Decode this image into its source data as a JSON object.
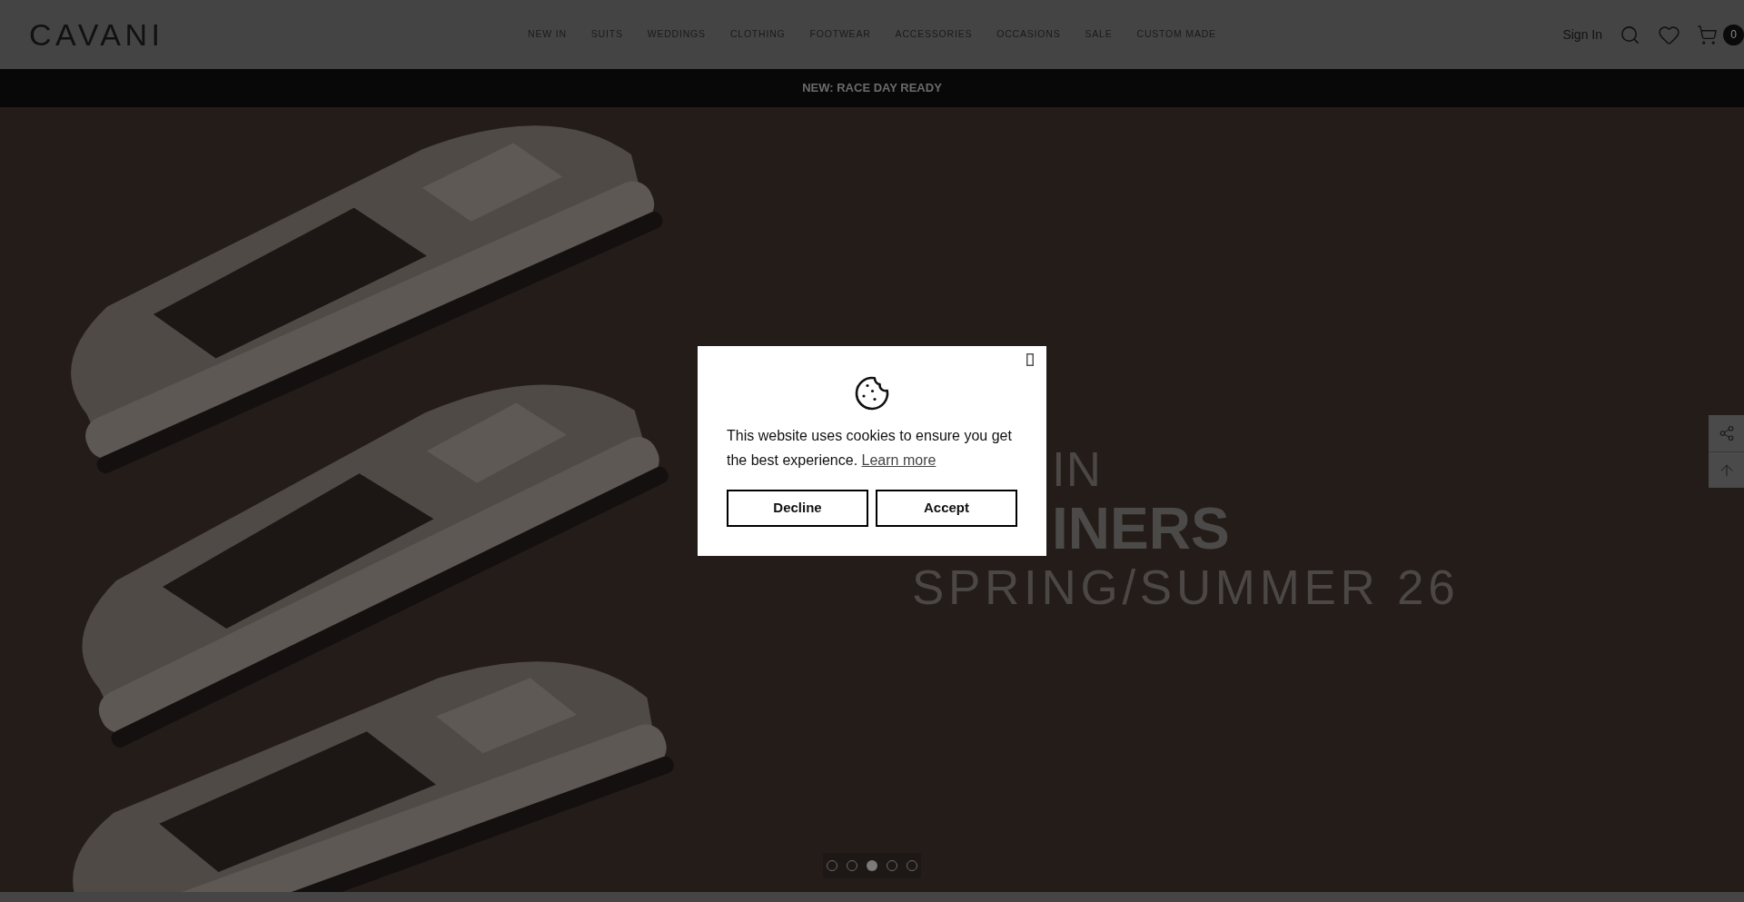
{
  "header": {
    "logo": "CAVANI",
    "nav": [
      "NEW IN",
      "SUITS",
      "WEDDINGS",
      "CLOTHING",
      "FOOTWEAR",
      "ACCESSORIES",
      "OCCASIONS",
      "SALE",
      "CUSTOM MADE"
    ],
    "sign_in": "Sign In",
    "cart_count": "0"
  },
  "announcement": "NEW: RACE DAY READY",
  "hero": {
    "lines": [
      {
        "text": "IN",
        "kind": "light"
      },
      {
        "text": "INERS",
        "kind": "bold"
      },
      {
        "text": "SPRING/SUMMER 26",
        "kind": "sub"
      }
    ],
    "slides": [
      {
        "selected": false
      },
      {
        "selected": false
      },
      {
        "selected": true
      },
      {
        "selected": false
      },
      {
        "selected": false
      }
    ]
  },
  "cookie_dialog": {
    "message": "This website uses cookies to ensure you get the best experience.",
    "link": "Learn more",
    "buttons": [
      "Decline",
      "Accept"
    ]
  }
}
